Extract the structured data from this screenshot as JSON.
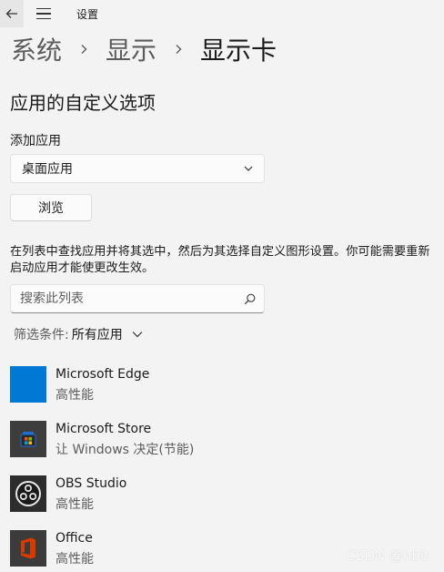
{
  "window": {
    "title": "设置"
  },
  "breadcrumb": {
    "items": [
      "系统",
      "显示",
      "显示卡"
    ]
  },
  "section_title": "应用的自定义选项",
  "add_app": {
    "label": "添加应用",
    "dropdown_value": "桌面应用",
    "browse_label": "浏览"
  },
  "description": "在列表中查找应用并将其选中，然后为其选择自定义图形设置。你可能需要重新启动应用才能使更改生效。",
  "search": {
    "placeholder": "搜索此列表"
  },
  "filter": {
    "label": "筛选条件:",
    "value": "所有应用"
  },
  "apps": [
    {
      "name": "Microsoft Edge",
      "setting": "高性能",
      "icon": "microsoft-edge-icon"
    },
    {
      "name": "Microsoft Store",
      "setting": "让 Windows 决定(节能)",
      "icon": "microsoft-store-icon"
    },
    {
      "name": "OBS Studio",
      "setting": "高性能",
      "icon": "obs-studio-icon"
    },
    {
      "name": "Office",
      "setting": "高性能",
      "icon": "office-icon"
    }
  ],
  "watermark": "CSDN @hbit",
  "colors": {
    "background": "#f3f3f3",
    "edge_tile": "#0078d4",
    "store_tile": "#3d3d3d",
    "obs_tile": "#2d2d2d",
    "office_tile": "#3b3b3b",
    "office_red": "#d83b01"
  }
}
